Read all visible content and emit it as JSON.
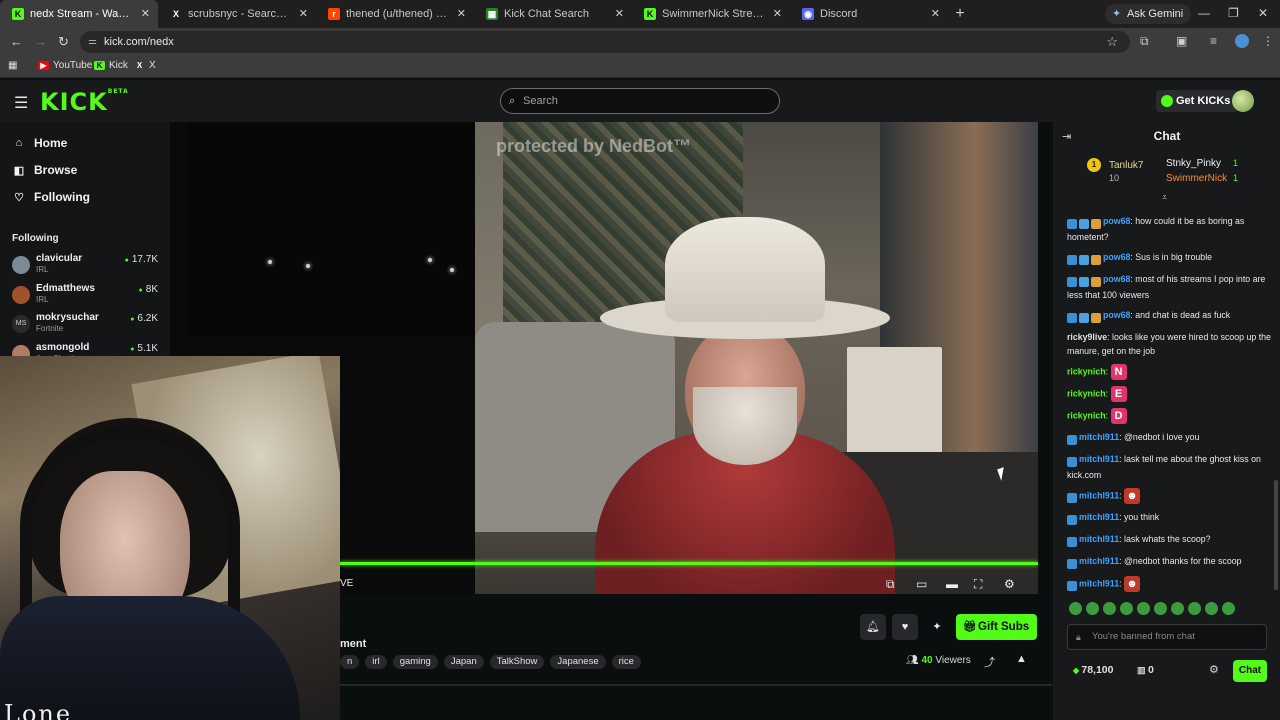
{
  "browser": {
    "tabs": [
      {
        "label": "nedx Stream - Watch Live on Kick",
        "favicon": "kick-favicon",
        "fav_text": "K",
        "fav_color": "#53fc18",
        "active": true
      },
      {
        "label": "scrubsnyc - Search / X",
        "favicon": "x-favicon",
        "fav_text": "X",
        "fav_color": "#1f1f1f",
        "active": false
      },
      {
        "label": "thened (u/thened) - Reddit",
        "favicon": "reddit-favicon",
        "fav_text": "r",
        "fav_color": "#ff4500",
        "active": false
      },
      {
        "label": "Kick Chat Search",
        "favicon": "chat-search-favicon",
        "fav_text": "▦",
        "fav_color": "#2e7d32",
        "active": false
      },
      {
        "label": "SwimmerNick Stream - Watch Live on Kick",
        "favicon": "kick-favicon",
        "fav_text": "K",
        "fav_color": "#53fc18",
        "active": false
      },
      {
        "label": "Discord",
        "favicon": "discord-favicon",
        "fav_text": "◉",
        "fav_color": "#5865f2",
        "active": false
      }
    ],
    "new_tab": "+",
    "gemini_label": "Ask Gemini",
    "url": "kick.com/nedx",
    "bookmarks": [
      {
        "label": "YouTube",
        "icon": "youtube-icon",
        "color": "#ff0000",
        "glyph": "▶"
      },
      {
        "label": "Kick",
        "icon": "kick-icon",
        "color": "#53fc18",
        "glyph": "K"
      },
      {
        "label": "X",
        "icon": "x-icon",
        "color": "#3c3c3c",
        "glyph": "X"
      }
    ]
  },
  "header": {
    "logo": "KICK",
    "logo_sup": "BETA",
    "search_placeholder": "Search",
    "get_kicks_label": "Get KICKs",
    "accent": "#53fc18"
  },
  "sidebar": {
    "nav": [
      {
        "label": "Home",
        "icon": "home-icon",
        "glyph": "⌂"
      },
      {
        "label": "Browse",
        "icon": "browse-icon",
        "glyph": "◧"
      },
      {
        "label": "Following",
        "icon": "heart-icon",
        "glyph": "♡"
      }
    ],
    "following_title": "Following",
    "following": [
      {
        "name": "clavicular",
        "category": "IRL",
        "viewers": "17.7K",
        "avatar": "#7d8a96",
        "mono": ""
      },
      {
        "name": "Edmatthews",
        "category": "IRL",
        "viewers": "8K",
        "avatar": "#a0522d",
        "mono": ""
      },
      {
        "name": "mokrysuchar",
        "category": "Fortnite",
        "viewers": "6.2K",
        "avatar": "#2a2a2a",
        "mono": "MS"
      },
      {
        "name": "asmongold",
        "category": "Just Chatting",
        "viewers": "5.1K",
        "avatar": "#b07c62",
        "mono": ""
      }
    ]
  },
  "video": {
    "watermark": "protected by NedBot™",
    "live_cut": "VE",
    "controls": [
      {
        "name": "miniplayer-icon",
        "glyph": "⧉"
      },
      {
        "name": "theater-mode-icon",
        "glyph": "▭"
      },
      {
        "name": "wide-mode-icon",
        "glyph": "▬"
      },
      {
        "name": "fullscreen-icon",
        "glyph": "⛶"
      },
      {
        "name": "settings-icon",
        "glyph": "⚙"
      }
    ]
  },
  "webcam": {
    "overlay_text": "Lone"
  },
  "stream_info": {
    "title_cut": "ment",
    "tags": [
      "n",
      "irl",
      "gaming",
      "Japan",
      "TalkShow",
      "Japanese",
      "rice"
    ],
    "viewers_count": "40",
    "viewers_label": "Viewers",
    "gift_subs_label": "Gift Subs"
  },
  "chat": {
    "title": "Chat",
    "gifters": [
      {
        "name": "Tanluk7",
        "count": "10",
        "rank": "1"
      },
      {
        "name": "Stnky_Pinky",
        "count": "1"
      },
      {
        "name": "SwimmerNick",
        "count": "1"
      }
    ],
    "messages": [
      {
        "user": "pow68",
        "color": "#3ba4ff",
        "text": "how could it be as boring as hometent?",
        "badges": [
          "#3a8fd6",
          "#4aa0e0",
          "#d9a13b"
        ]
      },
      {
        "user": "pow68",
        "color": "#3ba4ff",
        "text": "Sus is in big trouble",
        "badges": [
          "#3a8fd6",
          "#4aa0e0",
          "#d9a13b"
        ]
      },
      {
        "user": "pow68",
        "color": "#3ba4ff",
        "text": "most of his streams I pop into are less that 100 viewers",
        "badges": [
          "#3a8fd6",
          "#4aa0e0",
          "#d9a13b"
        ]
      },
      {
        "user": "pow68",
        "color": "#3ba4ff",
        "text": "and chat is dead as fuck",
        "badges": [
          "#3a8fd6",
          "#4aa0e0",
          "#d9a13b"
        ]
      },
      {
        "user": "ricky9live",
        "color": "#e0e0e0",
        "text": "looks like you were hired to scoop up the manure, get on the job",
        "badges": []
      },
      {
        "user": "rickynich",
        "color": "#53fc18",
        "text": "",
        "emote": "N",
        "emote_color": "#e2336b",
        "badges": []
      },
      {
        "user": "rickynich",
        "color": "#53fc18",
        "text": "",
        "emote": "E",
        "emote_color": "#e2336b",
        "badges": []
      },
      {
        "user": "rickynich",
        "color": "#53fc18",
        "text": "",
        "emote": "D",
        "emote_color": "#e2336b",
        "badges": []
      },
      {
        "user": "mitchl911",
        "color": "#3ba4ff",
        "text": "@nedbot i love you",
        "badges": [
          "#3a8fd6"
        ]
      },
      {
        "user": "mitchl911",
        "color": "#3ba4ff",
        "text": "lask tell me about the ghost kiss on kick.com",
        "badges": [
          "#3a8fd6"
        ]
      },
      {
        "user": "mitchl911",
        "color": "#3ba4ff",
        "text": "",
        "emote": "☻",
        "emote_color": "#c0392b",
        "badges": [
          "#3a8fd6"
        ]
      },
      {
        "user": "mitchl911",
        "color": "#3ba4ff",
        "text": "you think",
        "badges": [
          "#3a8fd6"
        ]
      },
      {
        "user": "mitchl911",
        "color": "#3ba4ff",
        "text": "lask whats the scoop?",
        "badges": [
          "#3a8fd6"
        ]
      },
      {
        "user": "mitchl911",
        "color": "#3ba4ff",
        "text": "@nedbot thanks for the scoop",
        "badges": [
          "#3a8fd6"
        ]
      },
      {
        "user": "mitchl911",
        "color": "#3ba4ff",
        "text": "",
        "emote": "☻",
        "emote_color": "#c0392b",
        "badges": [
          "#3a8fd6"
        ]
      },
      {
        "user": "mitchl911",
        "color": "#3ba4ff",
        "text": "what",
        "badges": [
          "#3a8fd6"
        ]
      }
    ],
    "input_placeholder": "You're banned from chat",
    "kicks_balance": "78,100",
    "points": "0",
    "chat_button": "Chat"
  }
}
